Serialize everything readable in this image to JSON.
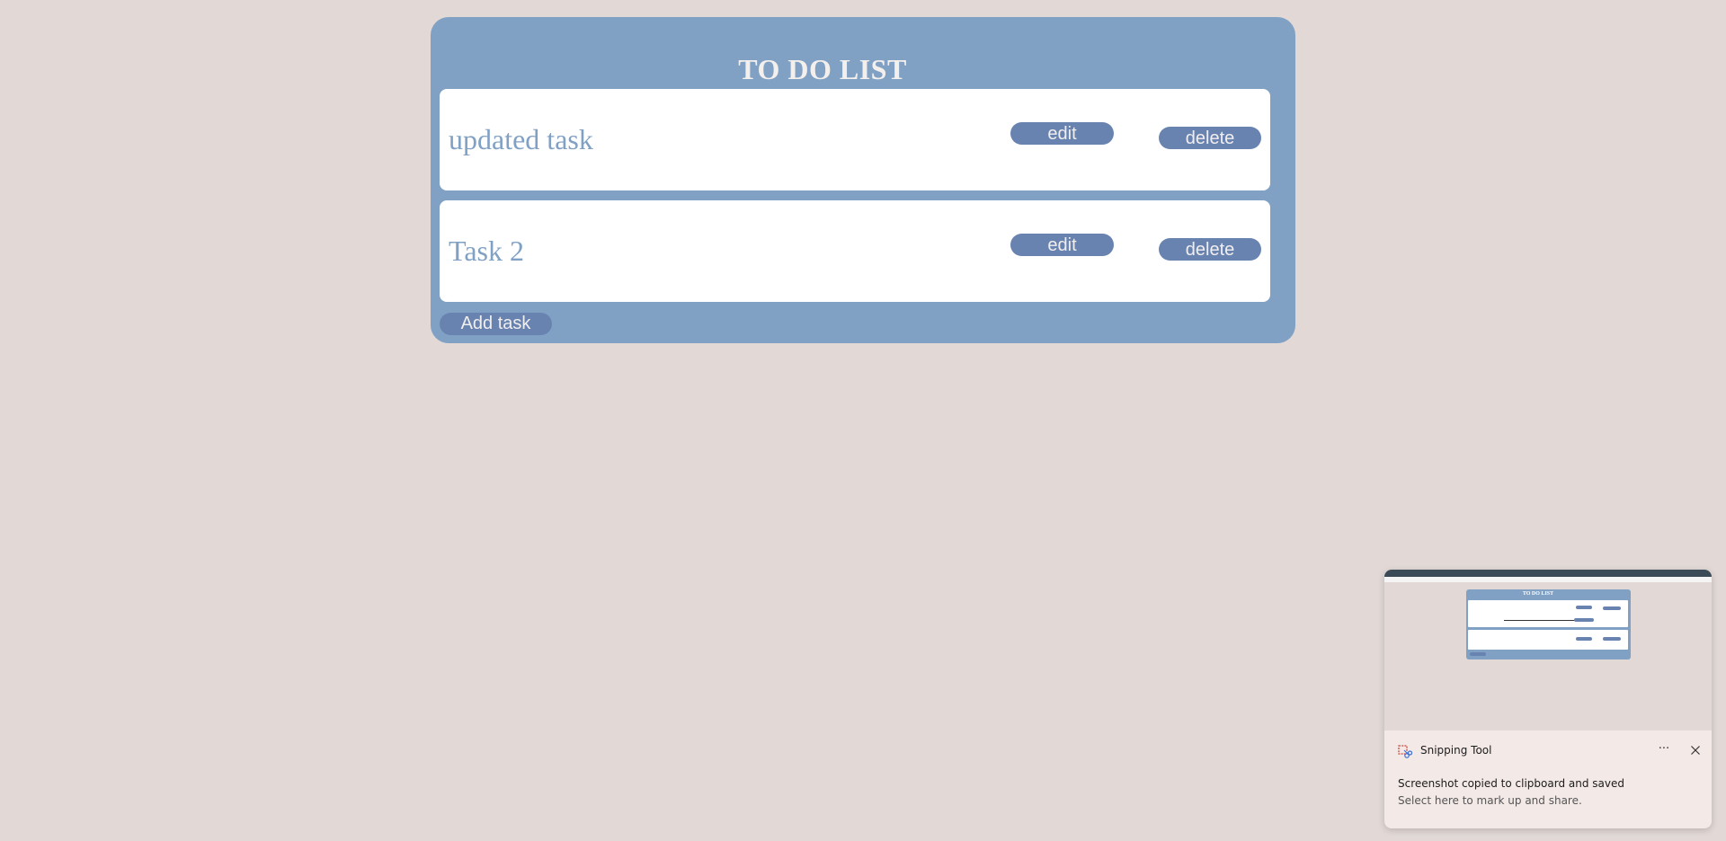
{
  "todo": {
    "title": "TO DO LIST",
    "tasks": [
      {
        "text": "updated task",
        "edit_label": "edit",
        "delete_label": "delete"
      },
      {
        "text": "Task 2",
        "edit_label": "edit",
        "delete_label": "delete"
      }
    ],
    "add_label": "Add task"
  },
  "toast": {
    "app_name": "Snipping Tool",
    "more_label": "···",
    "message": "Screenshot copied to clipboard and saved",
    "sub_message": "Select here to mark up and share.",
    "preview_title": "TO DO LIST"
  },
  "colors": {
    "page_background": "#e2d9d6",
    "card_background": "#80a1c4",
    "button_background": "#6983b1",
    "task_text": "#80a1c4"
  }
}
